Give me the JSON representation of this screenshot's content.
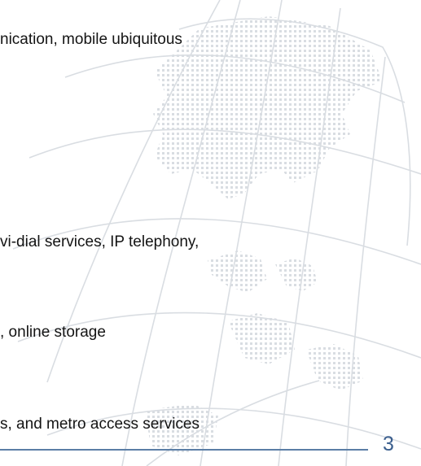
{
  "lines": [
    "nication, mobile ubiquitous",
    "vi-dial services, IP telephony,",
    ", online storage",
    "s, and metro access services"
  ],
  "page_number": "3",
  "colors": {
    "rule": "#5b7ea6",
    "page_number": "#3b5f8e",
    "globe_lines": "#d9dde2",
    "globe_dots": "#d2d6db"
  },
  "background_icon": "globe-map-watermark"
}
